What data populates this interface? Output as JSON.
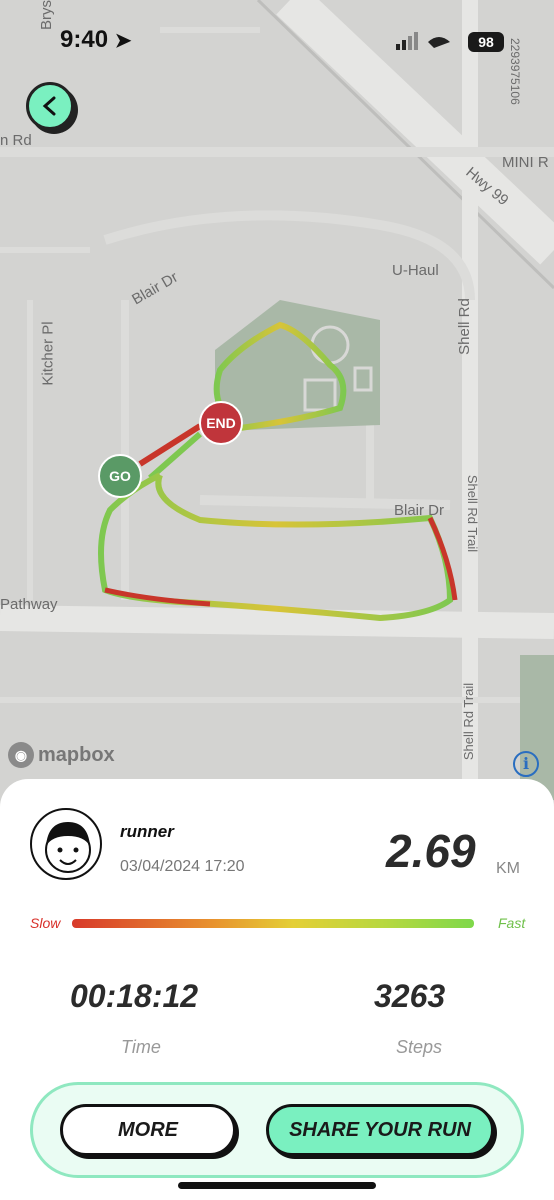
{
  "status_bar": {
    "time": "9:40",
    "battery": "98",
    "side_text": "2293975106"
  },
  "map": {
    "labels": {
      "brys": "Brys",
      "rd_top": "n Rd",
      "mini": "MINI R",
      "hwy99": "Hwy 99",
      "uhaul": "U-Haul",
      "blair_dr_top": "Blair Dr",
      "kitcher_pl": "Kitcher Pl",
      "shell_rd": "Shell Rd",
      "shell_rd_trail_top": "Shell Rd Trail",
      "blair_dr_mid": "Blair Dr",
      "pathway": "Pathway",
      "shell_rd_trail_bottom": "Shell Rd Trail"
    },
    "start_label": "GO",
    "end_label": "END",
    "attribution": "mapbox",
    "info_symbol": "i"
  },
  "run": {
    "username": "runner",
    "datetime": "03/04/2024 17:20",
    "distance": "2.69",
    "unit": "KM",
    "speed_legend": {
      "slow": "Slow",
      "fast": "Fast"
    },
    "time_value": "00:18:12",
    "time_label": "Time",
    "steps_value": "3263",
    "steps_label": "Steps"
  },
  "actions": {
    "more": "MORE",
    "share": "SHARE YOUR RUN"
  },
  "colors": {
    "accent": "#7af0c0",
    "slow": "#d83a2a",
    "fast": "#7ed84a",
    "start_pin": "#5a9a66",
    "end_pin": "#c0353b"
  }
}
